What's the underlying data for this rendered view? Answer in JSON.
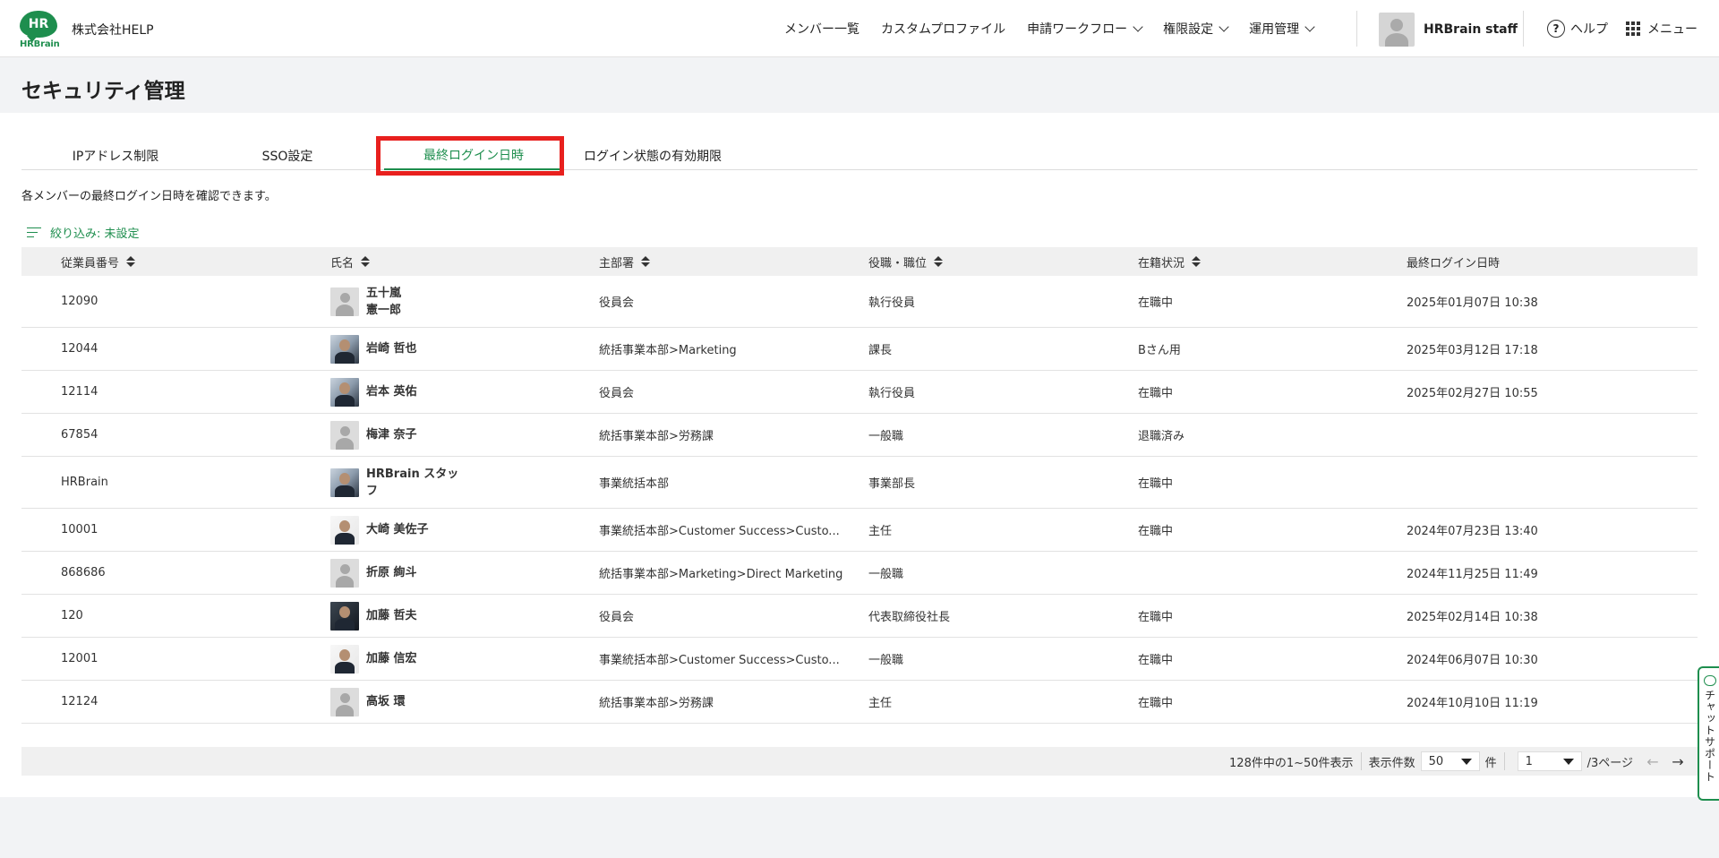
{
  "header": {
    "logo_badge": "HR",
    "logo_text": "HRBrain",
    "company": "株式会社HELP",
    "nav": [
      {
        "label": "メンバー一覧",
        "dropdown": false
      },
      {
        "label": "カスタムプロファイル",
        "dropdown": false
      },
      {
        "label": "申請ワークフロー",
        "dropdown": true
      },
      {
        "label": "権限設定",
        "dropdown": true
      },
      {
        "label": "運用管理",
        "dropdown": true
      }
    ],
    "user_name": "HRBrain staff",
    "help_label": "ヘルプ",
    "menu_label": "メニュー"
  },
  "page": {
    "title": "セキュリティ管理",
    "tabs": [
      {
        "label": "IPアドレス制限",
        "active": false
      },
      {
        "label": "SSO設定",
        "active": false
      },
      {
        "label": "最終ログイン日時",
        "active": true
      },
      {
        "label": "ログイン状態の有効期限",
        "active": false
      }
    ],
    "description": "各メンバーの最終ログイン日時を確認できます。",
    "filter_label": "絞り込み: 未設定"
  },
  "table": {
    "columns": [
      "従業員番号",
      "氏名",
      "主部署",
      "役職・職位",
      "在籍状況",
      "最終ログイン日時"
    ],
    "rows": [
      {
        "id": "12090",
        "name": "五十嵐\n憲一郎",
        "dept": "役員会",
        "title": "執行役員",
        "status": "在職中",
        "last_login": "2025年01月07日 10:38",
        "avatar": "default"
      },
      {
        "id": "12044",
        "name": "岩崎 哲也",
        "dept": "統括事業本部>Marketing",
        "title": "課長",
        "status": "Bさん用",
        "last_login": "2025年03月12日 17:18",
        "avatar": "photo"
      },
      {
        "id": "12114",
        "name": "岩本 英佑",
        "dept": "役員会",
        "title": "執行役員",
        "status": "在職中",
        "last_login": "2025年02月27日 10:55",
        "avatar": "photo"
      },
      {
        "id": "67854",
        "name": "梅津 奈子",
        "dept": "統括事業本部>労務課",
        "title": "一般職",
        "status": "退職済み",
        "last_login": "",
        "avatar": "default"
      },
      {
        "id": "HRBrain",
        "name": "HRBrain スタッ\nフ",
        "dept": "事業統括本部",
        "title": "事業部長",
        "status": "在職中",
        "last_login": "",
        "avatar": "photo"
      },
      {
        "id": "10001",
        "name": "大崎 美佐子",
        "dept": "事業統括本部>Customer Success>Custo...",
        "title": "主任",
        "status": "在職中",
        "last_login": "2024年07月23日 13:40",
        "avatar": "photo-light"
      },
      {
        "id": "868686",
        "name": "折原 絢斗",
        "dept": "統括事業本部>Marketing>Direct Marketing",
        "title": "一般職",
        "status": "",
        "last_login": "2024年11月25日 11:49",
        "avatar": "default"
      },
      {
        "id": "120",
        "name": "加藤 哲夫",
        "dept": "役員会",
        "title": "代表取締役社長",
        "status": "在職中",
        "last_login": "2025年02月14日 10:38",
        "avatar": "photo-dark"
      },
      {
        "id": "12001",
        "name": "加藤 信宏",
        "dept": "事業統括本部>Customer Success>Custo...",
        "title": "一般職",
        "status": "在職中",
        "last_login": "2024年06月07日 10:30",
        "avatar": "photo-light"
      },
      {
        "id": "12124",
        "name": "高坂 環",
        "dept": "統括事業本部>労務課",
        "title": "主任",
        "status": "在職中",
        "last_login": "2024年10月10日 11:19",
        "avatar": "default"
      }
    ]
  },
  "pagination": {
    "summary": "128件中の1~50件表示",
    "per_page_label": "表示件数",
    "per_page_value": "50",
    "per_page_unit": "件",
    "page_value": "1",
    "page_total": "/3ページ",
    "prev_icon": "←",
    "next_icon": "→"
  },
  "chat": {
    "label": "チャットサポート"
  },
  "colors": {
    "accent": "#1e8e4e",
    "highlight": "#e8201e"
  }
}
